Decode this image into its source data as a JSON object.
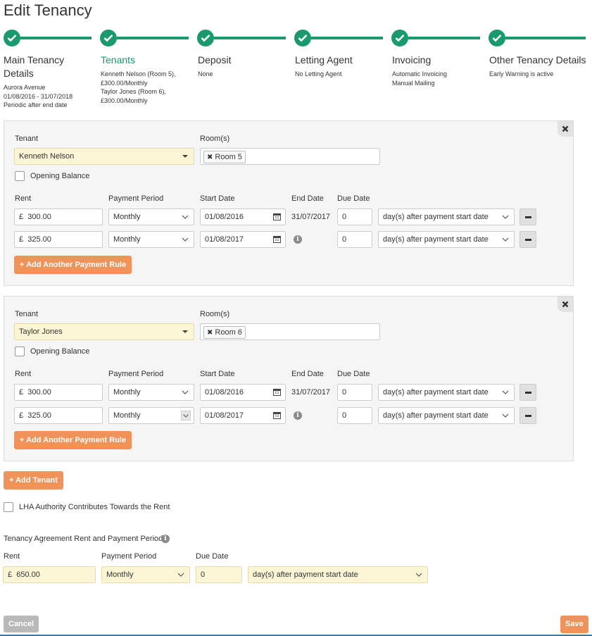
{
  "page": {
    "title": "Edit Tenancy"
  },
  "steps": [
    {
      "title_lines": [
        "Main Tenancy",
        "Details"
      ],
      "sub": [
        "Aurora Avenue",
        "01/08/2016 - 31/07/2018",
        "Periodic after end date"
      ]
    },
    {
      "title_lines": [
        "Tenants"
      ],
      "sub": [
        "Kenneth Nelson (Room 5),",
        "£300.00/Monthly",
        "Taylor Jones (Room 6),",
        "£300.00/Monthly"
      ]
    },
    {
      "title_lines": [
        "Deposit"
      ],
      "sub": [
        "None"
      ]
    },
    {
      "title_lines": [
        "Letting Agent"
      ],
      "sub": [
        "No Letting Agent"
      ]
    },
    {
      "title_lines": [
        "Invoicing"
      ],
      "sub": [
        "Automatic Invoicing",
        "Manual Mailing"
      ]
    },
    {
      "title_lines": [
        "Other Tenancy Details"
      ],
      "sub": [
        "Early Warning is active"
      ]
    }
  ],
  "labels": {
    "tenant": "Tenant",
    "rooms": "Room(s)",
    "opening_balance": "Opening Balance",
    "rent": "Rent",
    "payment_period": "Payment Period",
    "start_date": "Start Date",
    "end_date": "End Date",
    "due_date": "Due Date",
    "add_payment_rule": "Add Another Payment Rule",
    "currency": "£"
  },
  "tenants": [
    {
      "name": "Kenneth Nelson",
      "room": "Room 5",
      "rules": [
        {
          "rent": "300.00",
          "period": "Monthly",
          "start": "01/08/2016",
          "end": "31/07/2017",
          "due": "0",
          "due_type": "day(s) after payment start date"
        },
        {
          "rent": "325.00",
          "period": "Monthly",
          "start": "01/08/2017",
          "end": "",
          "due": "0",
          "due_type": "day(s) after payment start date"
        }
      ]
    },
    {
      "name": "Taylor Jones",
      "room": "Room 6",
      "rules": [
        {
          "rent": "300.00",
          "period": "Monthly",
          "start": "01/08/2016",
          "end": "31/07/2017",
          "due": "0",
          "due_type": "day(s) after payment start date"
        },
        {
          "rent": "325.00",
          "period": "Monthly",
          "start": "01/08/2017",
          "end": "",
          "due": "0",
          "due_type": "day(s) after payment start date"
        }
      ]
    }
  ],
  "add_tenant": "Add Tenant",
  "lha": "LHA Authority Contributes Towards the Rent",
  "agreement": {
    "heading": "Tenancy Agreement Rent and Payment Period",
    "rent_label": "Rent",
    "period_label": "Payment Period",
    "due_label": "Due Date",
    "rent": "650.00",
    "period": "Monthly",
    "due": "0",
    "due_type": "day(s) after payment start date"
  },
  "footer": {
    "cancel": "Cancel",
    "save": "Save"
  },
  "colors": {
    "accent": "#1a9a6c",
    "orange": "#f0935a",
    "highlight": "#fcf6d6"
  }
}
